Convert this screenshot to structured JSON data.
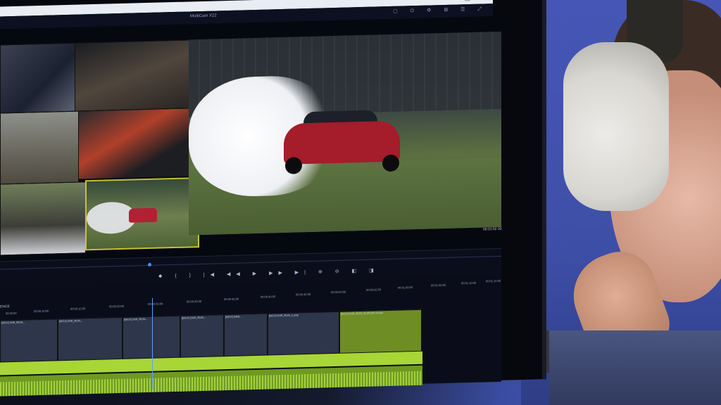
{
  "window": {
    "controls": "— ☐ ✕"
  },
  "app": {
    "title": "MultiCam X22",
    "toolbar_icons": "▢ ⏻ ⚙ ⊞ ☰ ⤢"
  },
  "preview": {
    "timecode": "00:01:02:30"
  },
  "transport": {
    "buttons": "◆ { } |◀ ◀◀ ▶ ▶▶ ▶| ⊕ ⊖ ◧ ◨"
  },
  "timeline": {
    "sequence_label": "ENCE",
    "ruler_ticks": [
      "00:00:00",
      "00:00:10:00",
      "00:00:15:00",
      "00:00:20:00",
      "00:00:25:00",
      "00:00:30:00",
      "00:00:35:00",
      "00:00:40:00",
      "00:00:45:00",
      "00:00:50:00",
      "00:00:55:00",
      "00:01:00:00",
      "00:01:05:00",
      "00:01:10:00",
      "00:01:15:00"
    ],
    "clips": [
      "[MC#] Drift_RUN...",
      "[MC#] Drift_RUN...",
      "[MC#] Drift_RUN...",
      "[MC#] DAR_RUN...",
      "[MC#] DAR...",
      "[MC#] Drift_RUN_Lumy",
      "[MC#] Drift_RUN_GoPro02 Drone"
    ]
  }
}
